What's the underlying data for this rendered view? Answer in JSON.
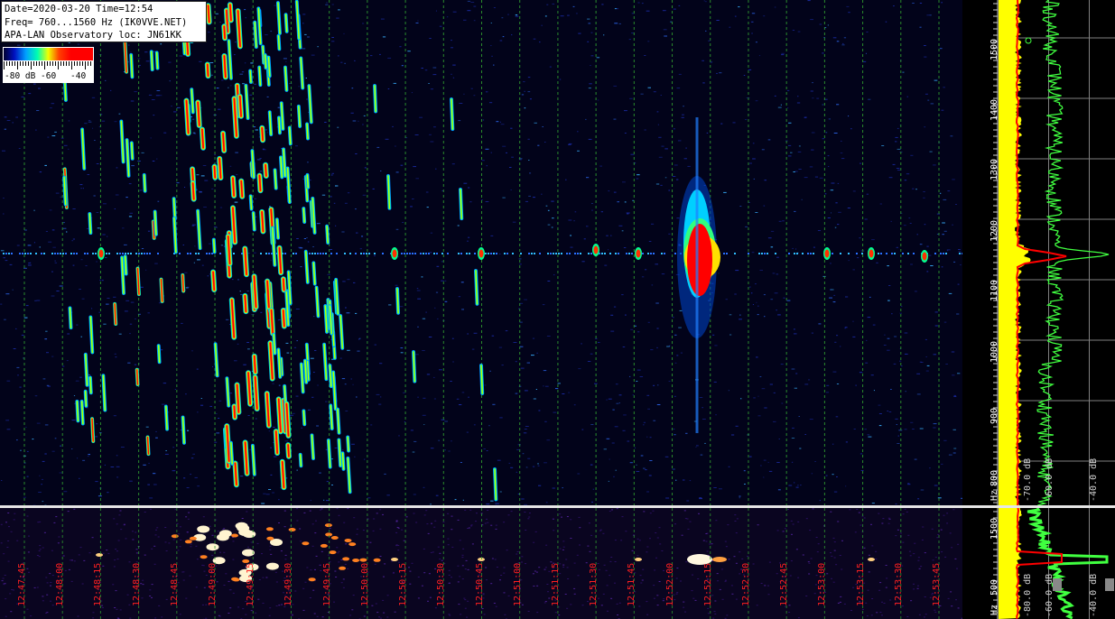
{
  "info": {
    "line1": "Date=2020-03-20 Time=12:54",
    "line2": "Freq= 760...1560 Hz (IK0VVE.NET)",
    "line3": "APA-LAN Observatory loc: JN61KK"
  },
  "legend": {
    "labels": [
      "-80 dB",
      "-60",
      "-40"
    ]
  },
  "time_labels": [
    "12:47:45",
    "12:48:00",
    "12:48:15",
    "12:48:30",
    "12:48:45",
    "12:49:00",
    "12:49:15",
    "12:49:30",
    "12:49:45",
    "12:50:00",
    "12:50:15",
    "12:50:30",
    "12:50:45",
    "12:51:00",
    "12:51:15",
    "12:51:30",
    "12:51:45",
    "12:52:00",
    "12:52:15",
    "12:52:30",
    "12:52:45",
    "12:53:00",
    "12:53:15",
    "12:53:30",
    "12:53:45"
  ],
  "freq_axis": {
    "labels": [
      "1500",
      "1400",
      "1300",
      "1200",
      "1100",
      "1000",
      "900",
      "800"
    ],
    "unit": "Hz"
  },
  "sub_freq_axis": {
    "labels": [
      "1500",
      "500"
    ],
    "unit": "Hz"
  },
  "db_axis": {
    "labels": [
      "-70.0 dB",
      "-60.0 dB",
      "-40.0 dB"
    ]
  },
  "sub_db_axis": {
    "labels": [
      "-80.0 dB",
      "-60.0 dB",
      "-40.0 dB"
    ]
  },
  "colors": {
    "background": "#02031a",
    "time_label": "#ff2020",
    "grid": "#2f9a2f",
    "trace_yellow": "#ffff00",
    "trace_green": "#40ff40",
    "trace_red": "#ff0000"
  }
}
